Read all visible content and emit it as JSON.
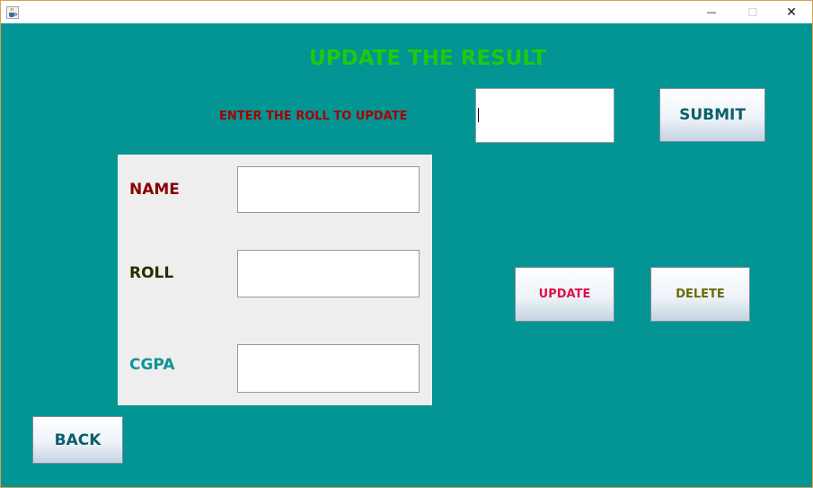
{
  "window": {
    "minimize_glyph": "—",
    "maximize_glyph": "☐",
    "close_glyph": "✕"
  },
  "form": {
    "heading": "UPDATE THE RESULT",
    "roll_prompt": "ENTER THE ROLL TO UPDATE",
    "roll_search_value": "",
    "submit_label": "SUBMIT",
    "name_label": "NAME",
    "roll_label": "ROLL",
    "cgpa_label": "CGPA",
    "name_value": "",
    "roll_value": "",
    "cgpa_value": "",
    "update_label": "UPDATE",
    "delete_label": "DELETE",
    "back_label": "BACK"
  },
  "colors": {
    "background": "#029594",
    "heading": "#22c711",
    "roll_prompt": "#a70000",
    "name_label": "#8a0000",
    "roll_label": "#2c2c00",
    "cgpa_label": "#0f9596",
    "submit_text": "#0b5f6a",
    "update_text": "#e0104a",
    "delete_text": "#6b6b00",
    "back_text": "#0b5f6a"
  },
  "icons": {
    "app": "java-cup-icon"
  }
}
